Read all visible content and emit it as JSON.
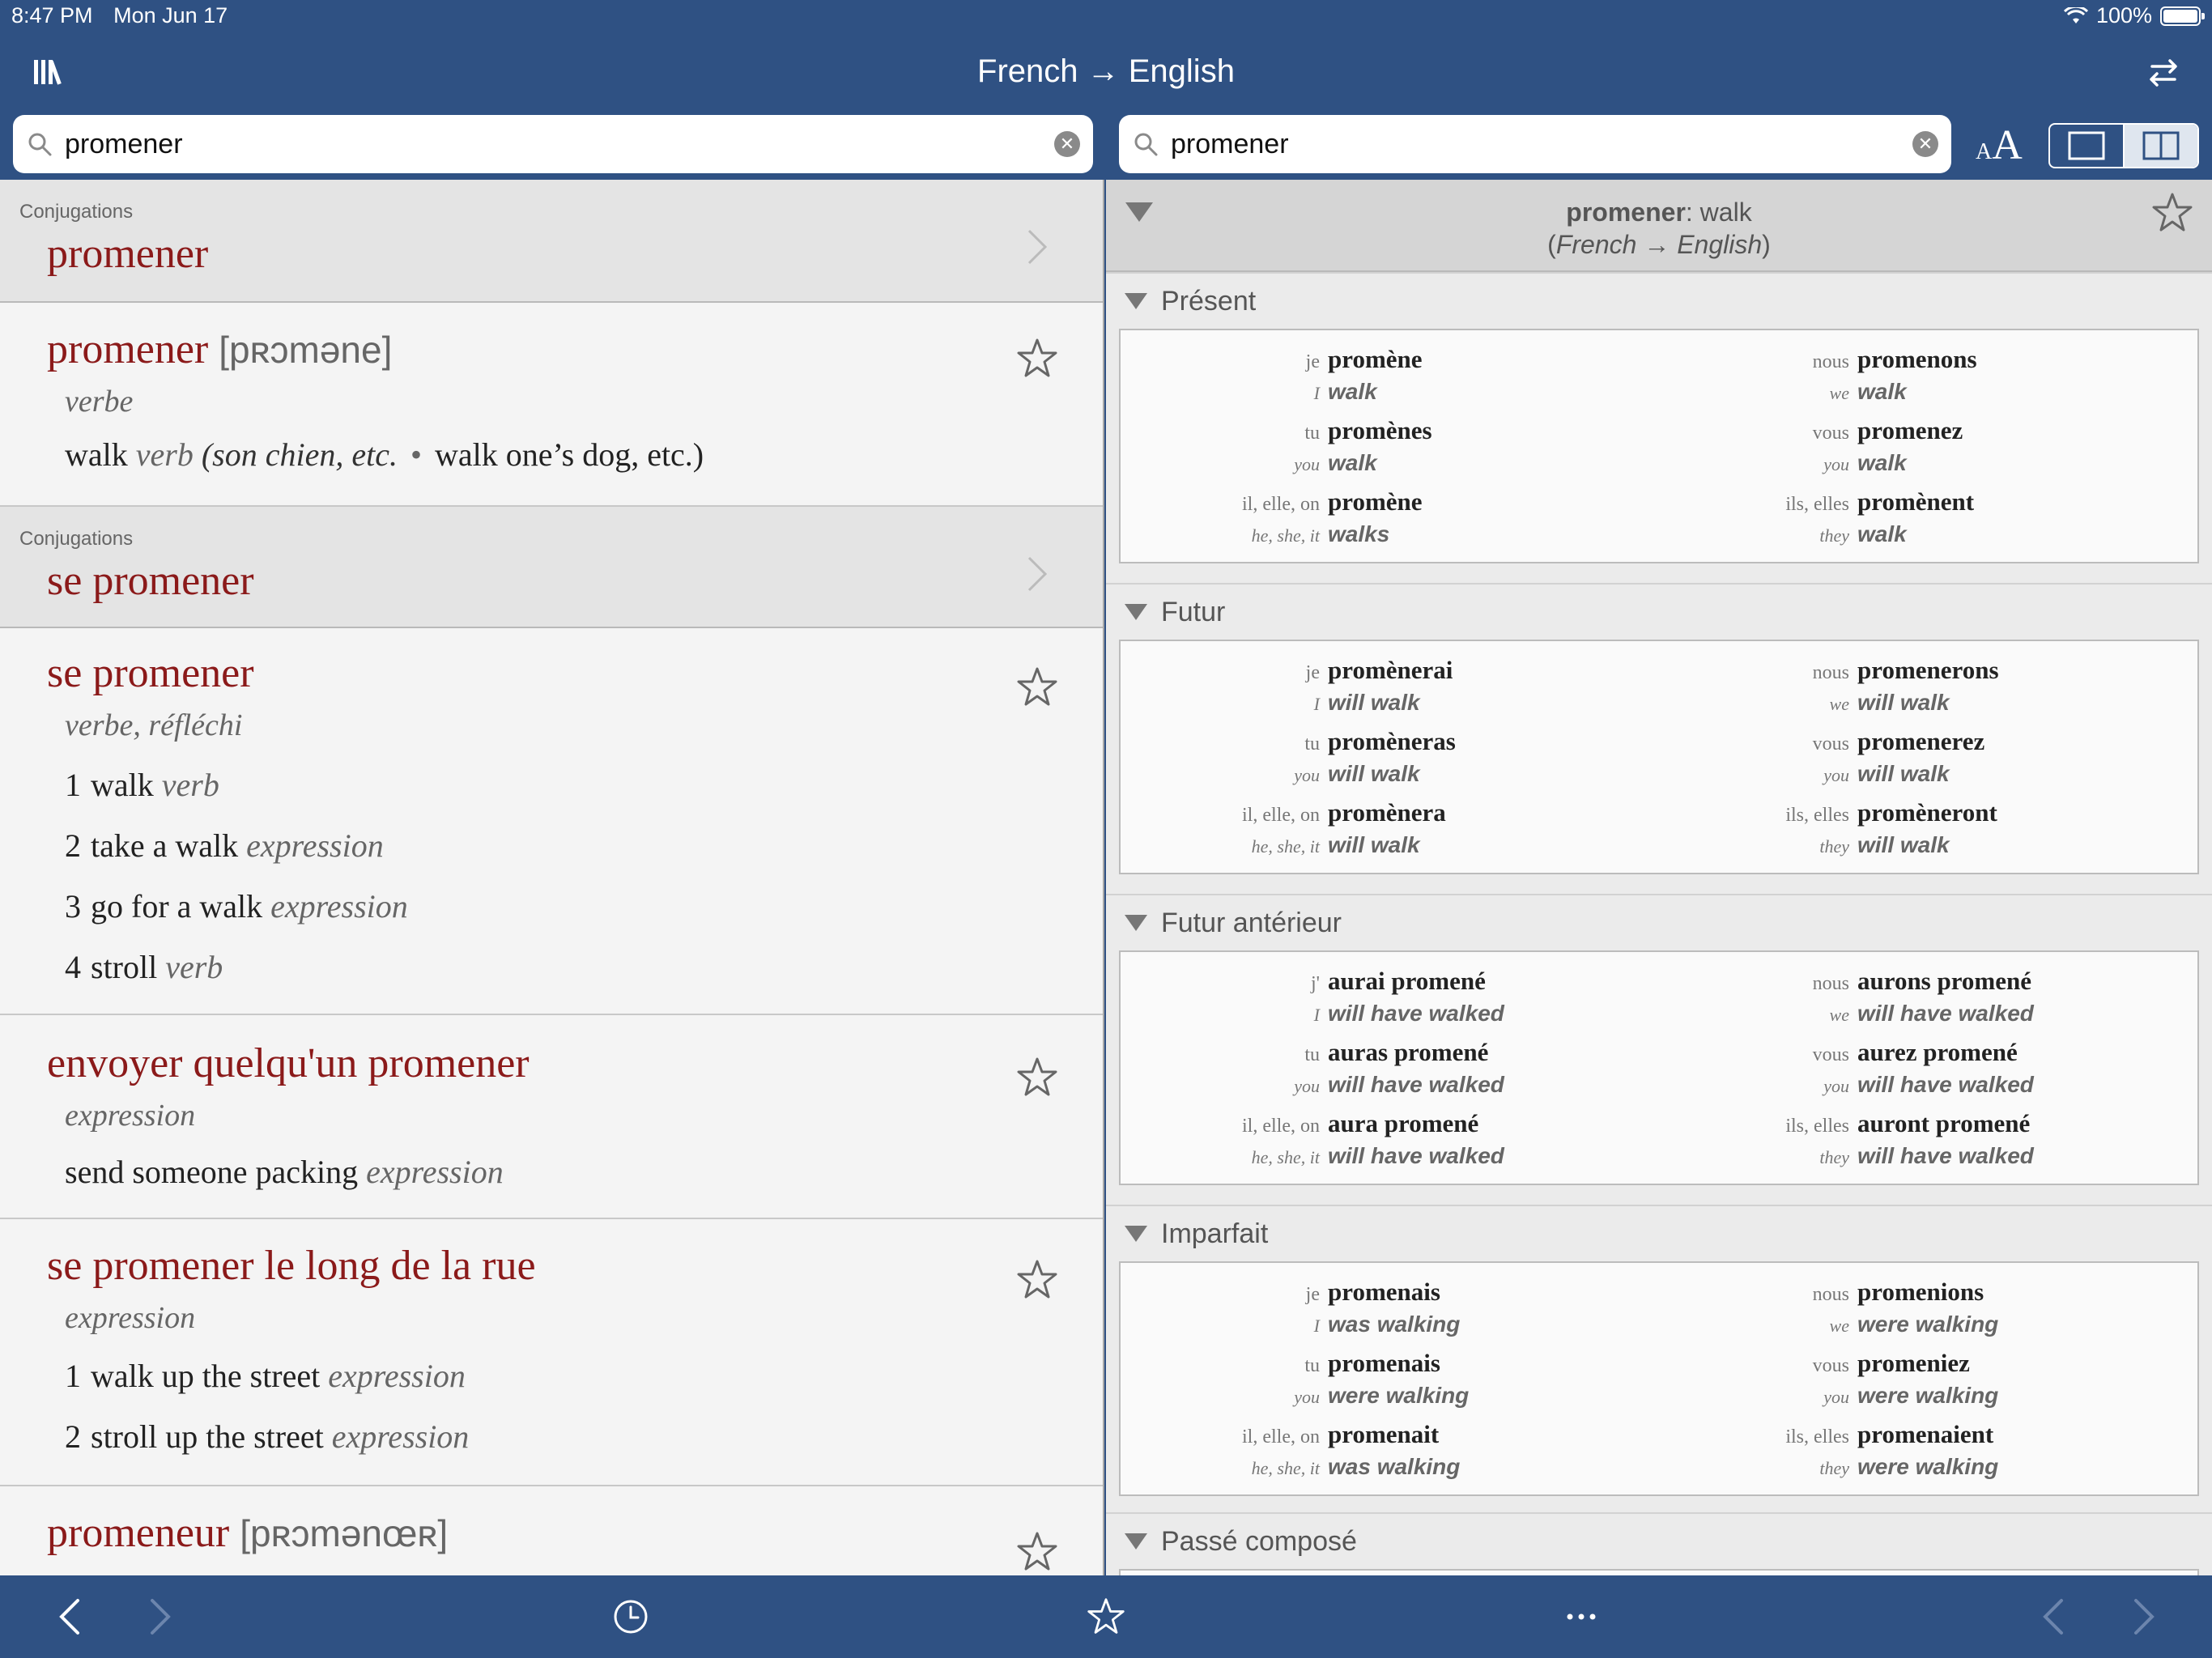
{
  "status_bar": {
    "time": "8:47 PM",
    "date": "Mon Jun 17",
    "battery": "100%"
  },
  "header": {
    "title": "French → English"
  },
  "search_left": {
    "value": "promener"
  },
  "search_right": {
    "value": "promener"
  },
  "font_control": {
    "small": "A",
    "big": "A"
  },
  "left": {
    "conj1": {
      "caption": "Conjugations",
      "headword": "promener"
    },
    "entry1": {
      "headword": "promener",
      "ipa": "[pʀɔmǝne]",
      "pos": "verbe",
      "sense_word": "walk",
      "sense_pos": "verb",
      "sense_ctx": "(son chien, etc.",
      "sense_dot": "•",
      "sense_trans": "walk one’s dog, etc.)"
    },
    "conj2": {
      "caption": "Conjugations",
      "headword": "se promener"
    },
    "entry2": {
      "headword": "se promener",
      "pos": "verbe, réfléchi",
      "senses": [
        {
          "num": "1",
          "text": "walk",
          "pos": "verb"
        },
        {
          "num": "2",
          "text": "take a walk",
          "pos": "expression"
        },
        {
          "num": "3",
          "text": "go for a walk",
          "pos": "expression"
        },
        {
          "num": "4",
          "text": "stroll",
          "pos": "verb"
        }
      ]
    },
    "entry3": {
      "headword": "envoyer quelqu'un promener",
      "pos": "expression",
      "sense_text": "send someone packing",
      "sense_pos": "expression"
    },
    "entry4": {
      "headword": "se promener le long de la rue",
      "pos": "expression",
      "senses": [
        {
          "num": "1",
          "text": "walk up the street",
          "pos": "expression"
        },
        {
          "num": "2",
          "text": "stroll up the street",
          "pos": "expression"
        }
      ]
    },
    "entry5": {
      "headword": "promeneur",
      "ipa": "[pʀɔmǝnœʀ]"
    }
  },
  "right": {
    "header": {
      "word": "promener",
      "sep": ":",
      "gloss": "walk",
      "direction": "French → English"
    },
    "tenses": [
      {
        "name": "Présent",
        "rows": [
          {
            "p": "je",
            "fr": "promène",
            "ep": "I",
            "en": "walk",
            "p2": "nous",
            "fr2": "promenons",
            "ep2": "we",
            "en2": "walk"
          },
          {
            "p": "tu",
            "fr": "promènes",
            "ep": "you",
            "en": "walk",
            "p2": "vous",
            "fr2": "promenez",
            "ep2": "you",
            "en2": "walk"
          },
          {
            "p": "il, elle, on",
            "fr": "promène",
            "ep": "he, she, it",
            "en": "walks",
            "p2": "ils, elles",
            "fr2": "promènent",
            "ep2": "they",
            "en2": "walk"
          }
        ]
      },
      {
        "name": "Futur",
        "rows": [
          {
            "p": "je",
            "fr": "promènerai",
            "ep": "I",
            "en": "will walk",
            "p2": "nous",
            "fr2": "promenerons",
            "ep2": "we",
            "en2": "will walk"
          },
          {
            "p": "tu",
            "fr": "promèneras",
            "ep": "you",
            "en": "will walk",
            "p2": "vous",
            "fr2": "promenerez",
            "ep2": "you",
            "en2": "will walk"
          },
          {
            "p": "il, elle, on",
            "fr": "promènera",
            "ep": "he, she, it",
            "en": "will walk",
            "p2": "ils, elles",
            "fr2": "promèneront",
            "ep2": "they",
            "en2": "will walk"
          }
        ]
      },
      {
        "name": "Futur antérieur",
        "rows": [
          {
            "p": "j'",
            "fr": "aurai promené",
            "ep": "I",
            "en": "will have walked",
            "p2": "nous",
            "fr2": "aurons promené",
            "ep2": "we",
            "en2": "will have walked"
          },
          {
            "p": "tu",
            "fr": "auras promené",
            "ep": "you",
            "en": "will have walked",
            "p2": "vous",
            "fr2": "aurez promené",
            "ep2": "you",
            "en2": "will have walked"
          },
          {
            "p": "il, elle, on",
            "fr": "aura promené",
            "ep": "he, she, it",
            "en": "will have walked",
            "p2": "ils, elles",
            "fr2": "auront promené",
            "ep2": "they",
            "en2": "will have walked"
          }
        ]
      },
      {
        "name": "Imparfait",
        "rows": [
          {
            "p": "je",
            "fr": "promenais",
            "ep": "I",
            "en": "was walking",
            "p2": "nous",
            "fr2": "promenions",
            "ep2": "we",
            "en2": "were walking"
          },
          {
            "p": "tu",
            "fr": "promenais",
            "ep": "you",
            "en": "were walking",
            "p2": "vous",
            "fr2": "promeniez",
            "ep2": "you",
            "en2": "were walking"
          },
          {
            "p": "il, elle, on",
            "fr": "promenait",
            "ep": "he, she, it",
            "en": "was walking",
            "p2": "ils, elles",
            "fr2": "promenaient",
            "ep2": "they",
            "en2": "were walking"
          }
        ]
      }
    ],
    "last_tense": "Passé composé"
  },
  "colors": {
    "bar": "#2f5183",
    "headword": "#8b1a1a"
  },
  "icons": [
    "library-icon",
    "swap-icon",
    "search-icon",
    "clear-icon",
    "star-icon",
    "chevron-right-icon",
    "back-icon",
    "forward-icon",
    "history-icon",
    "favorites-icon",
    "more-icon",
    "disclosure-triangle-icon"
  ]
}
